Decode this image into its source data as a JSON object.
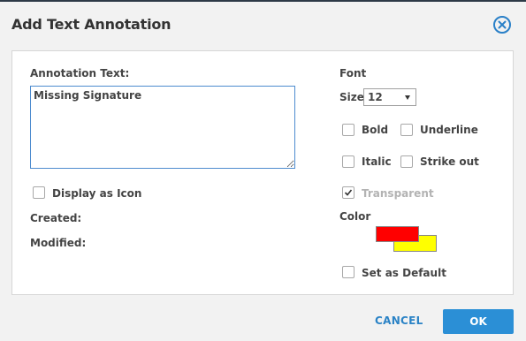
{
  "dialog": {
    "title": "Add Text Annotation",
    "close_icon": "close-circle-icon"
  },
  "left": {
    "annotation_label": "Annotation Text:",
    "annotation_value": "Missing Signature",
    "display_as_icon_label": "Display as Icon",
    "display_as_icon_checked": false,
    "created_label": "Created:",
    "modified_label": "Modified:"
  },
  "right": {
    "font_label": "Font",
    "size_label": "Size",
    "size_value": "12",
    "bold_label": "Bold",
    "bold_checked": false,
    "underline_label": "Underline",
    "underline_checked": false,
    "italic_label": "Italic",
    "italic_checked": false,
    "strikeout_label": "Strike out",
    "strikeout_checked": false,
    "transparent_label": "Transparent",
    "transparent_checked": true,
    "transparent_disabled": true,
    "color_label": "Color",
    "foreground_color": "#ff0000",
    "background_color": "#ffff00",
    "set_default_label": "Set as Default",
    "set_default_checked": false
  },
  "footer": {
    "cancel_label": "CANCEL",
    "ok_label": "OK"
  },
  "colors": {
    "accent": "#2b8fd6",
    "close_icon": "#2a80c8"
  }
}
